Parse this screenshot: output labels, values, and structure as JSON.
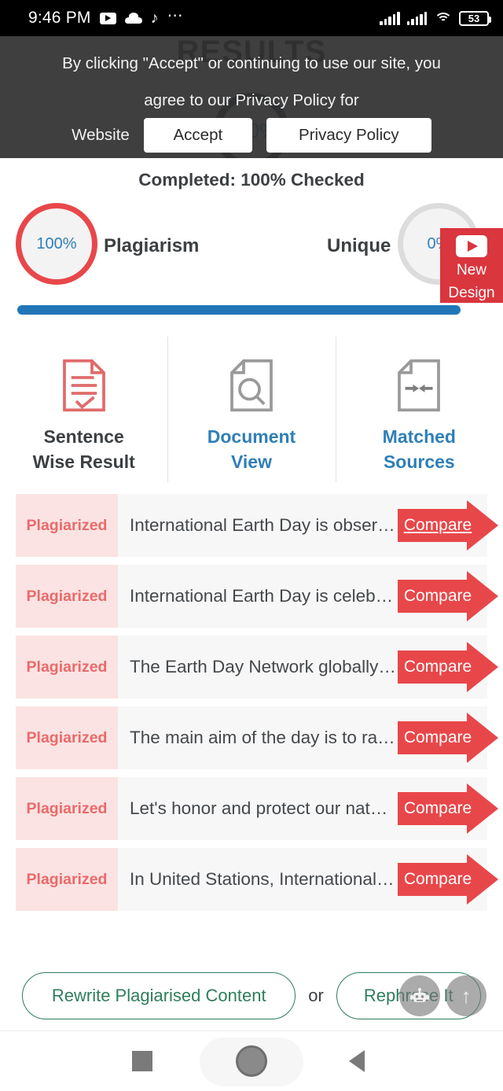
{
  "status_bar": {
    "time": "9:46 PM",
    "icons": [
      "youtube-icon",
      "cloud-icon",
      "tiktok-icon",
      "more-dots-icon"
    ],
    "battery_percent": "53",
    "signal": "signal-bars-icon",
    "wifi": "wifi-icon"
  },
  "behind_overlay": {
    "page_title": "RESULTS",
    "circle_value": "100%"
  },
  "cookie_banner": {
    "line1": "By clicking \"Accept\" or continuing to use our site, you",
    "line2": "agree to our Privacy Policy for",
    "line3": "Website",
    "accept_label": "Accept",
    "privacy_label": "Privacy Policy"
  },
  "summary": {
    "completed_text": "Completed: 100% Checked",
    "plagiarism_value": "100%",
    "plagiarism_label": "Plagiarism",
    "unique_label": "Unique",
    "unique_value": "0%",
    "progress_percent": "100"
  },
  "new_design_badge": {
    "icon": "youtube-play-icon",
    "line1": "New",
    "line2": "Design"
  },
  "tabs": [
    {
      "label_line1": "Sentence",
      "label_line2": "Wise Result",
      "icon": "document-check-icon",
      "active": true
    },
    {
      "label_line1": "Document",
      "label_line2": "View",
      "icon": "document-search-icon",
      "active": false
    },
    {
      "label_line1": "Matched",
      "label_line2": "Sources",
      "icon": "document-arrows-icon",
      "active": false
    }
  ],
  "sentence_rows": [
    {
      "tag": "Plagiarized",
      "text": "International Earth Day is obser…",
      "compare_label": "Compare",
      "underlined": true
    },
    {
      "tag": "Plagiarized",
      "text": "International Earth Day is celeb…",
      "compare_label": "Compare",
      "underlined": false
    },
    {
      "tag": "Plagiarized",
      "text": "The Earth Day Network globally…",
      "compare_label": "Compare",
      "underlined": false
    },
    {
      "tag": "Plagiarized",
      "text": "The main aim of the day is to ra…",
      "compare_label": "Compare",
      "underlined": false
    },
    {
      "tag": "Plagiarized",
      "text": "Let's honor and protect our nat…",
      "compare_label": "Compare",
      "underlined": false
    },
    {
      "tag": "Plagiarized",
      "text": "In United Stations, International…",
      "compare_label": "Compare",
      "underlined": false
    }
  ],
  "actions": {
    "rewrite_label": "Rewrite Plagiarised Content",
    "or_label": "or",
    "rephrase_label": "Rephrase It",
    "scroll_top_icon": "arrow-up-icon",
    "chatbot_icon": "robot-icon"
  },
  "nav_bar": {
    "recents": "square-recents-icon",
    "home": "circle-home-icon",
    "back": "triangle-back-icon"
  },
  "colors": {
    "red": "#e8474a",
    "badge_red": "#d9363e",
    "blue": "#2f7fb8",
    "progress_blue": "#2176b8",
    "green": "#2e7d5b",
    "tag_bg": "#fbe3e3",
    "row_bg": "#f7f7f7"
  }
}
